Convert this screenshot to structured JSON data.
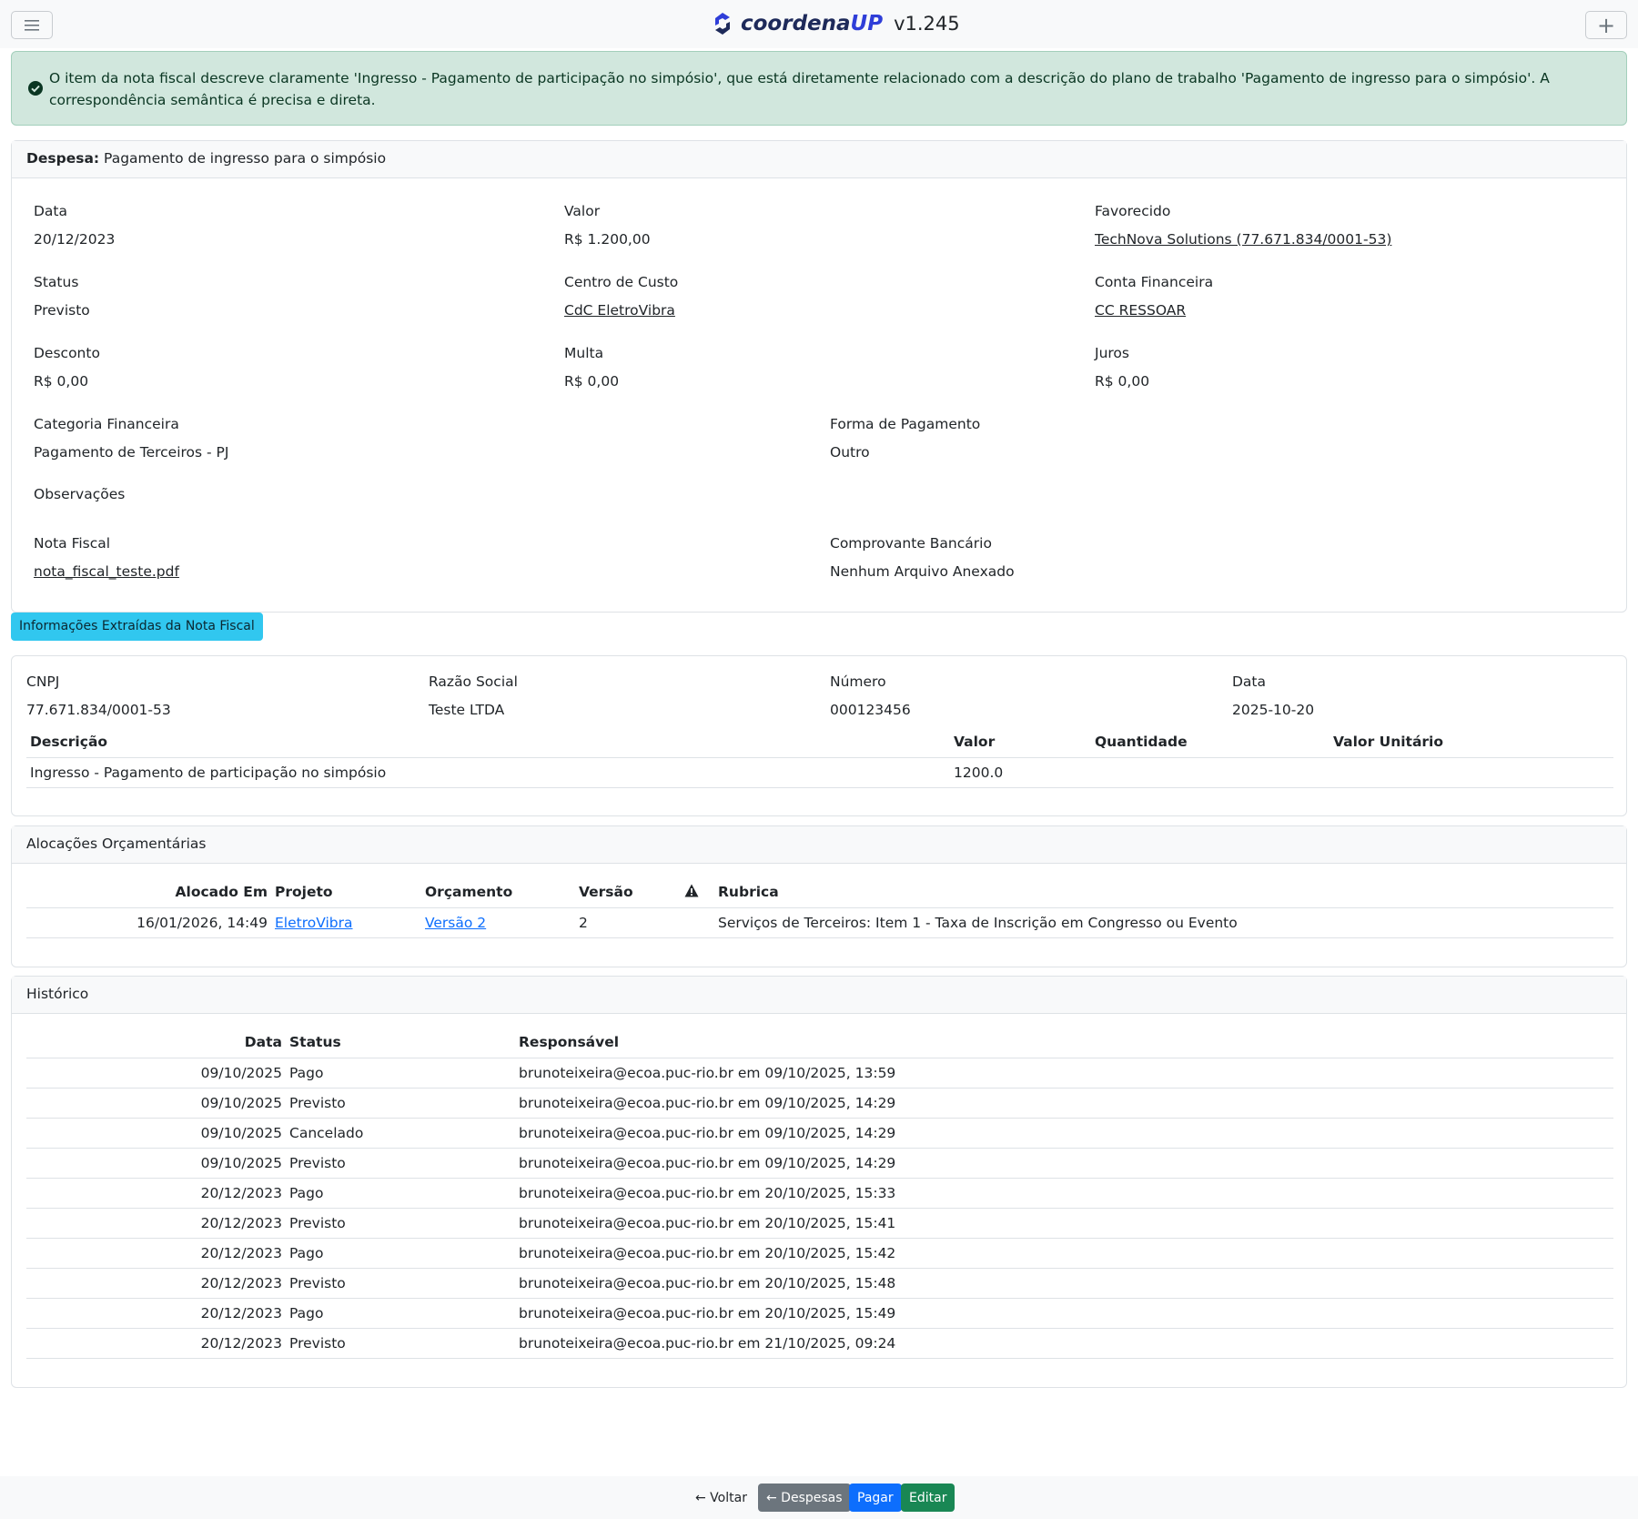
{
  "header": {
    "brand_name": "coordena",
    "brand_up": "UP",
    "version": "v1.245"
  },
  "alert": {
    "text": "O item da nota fiscal descreve claramente 'Ingresso - Pagamento de participação no simpósio', que está diretamente relacionado com a descrição do plano de trabalho 'Pagamento de ingresso para o simpósio'. A correspondência semântica é precisa e direta."
  },
  "expense": {
    "header_label": "Despesa:",
    "header_value": "Pagamento de ingresso para o simpósio",
    "fields": {
      "data_label": "Data",
      "data_value": "20/12/2023",
      "valor_label": "Valor",
      "valor_value": "R$ 1.200,00",
      "favorecido_label": "Favorecido",
      "favorecido_value": "TechNova Solutions (77.671.834/0001-53)",
      "status_label": "Status",
      "status_value": "Previsto",
      "centro_label": "Centro de Custo",
      "centro_value": "CdC EletroVibra",
      "conta_label": "Conta Financeira",
      "conta_value": "CC RESSOAR",
      "desconto_label": "Desconto",
      "desconto_value": "R$ 0,00",
      "multa_label": "Multa",
      "multa_value": "R$ 0,00",
      "juros_label": "Juros",
      "juros_value": "R$ 0,00",
      "categoria_label": "Categoria Financeira",
      "categoria_value": "Pagamento de Terceiros - PJ",
      "forma_label": "Forma de Pagamento",
      "forma_value": "Outro",
      "obs_label": "Observações",
      "nota_label": "Nota Fiscal",
      "nota_value": "nota_fiscal_teste.pdf",
      "comprovante_label": "Comprovante Bancário",
      "comprovante_value": "Nenhum Arquivo Anexado"
    }
  },
  "extracted": {
    "badge": "Informações Extraídas da Nota Fiscal",
    "cnpj_label": "CNPJ",
    "cnpj_value": "77.671.834/0001-53",
    "razao_label": "Razão Social",
    "razao_value": "Teste LTDA",
    "numero_label": "Número",
    "numero_value": "000123456",
    "data_label": "Data",
    "data_value": "2025-10-20",
    "columns": [
      "Descrição",
      "Valor",
      "Quantidade",
      "Valor Unitário"
    ],
    "rows": [
      {
        "descricao": "Ingresso - Pagamento de participação no simpósio",
        "valor": "1200.0",
        "quantidade": "",
        "valor_unitario": ""
      }
    ]
  },
  "allocations": {
    "title": "Alocações Orçamentárias",
    "columns": [
      "Alocado Em",
      "Projeto",
      "Orçamento",
      "Versão",
      "",
      "Rubrica"
    ],
    "rows": [
      {
        "alocado_em": "16/01/2026, 14:49",
        "projeto": "EletroVibra",
        "orcamento": "Versão 2",
        "versao": "2",
        "rubrica": "Serviços de Terceiros: Item 1 - Taxa de Inscrição em Congresso ou Evento"
      }
    ]
  },
  "history": {
    "title": "Histórico",
    "columns": [
      "Data",
      "Status",
      "Responsável"
    ],
    "rows": [
      {
        "data": "09/10/2025",
        "status": "Pago",
        "responsavel": "brunoteixeira@ecoa.puc-rio.br em 09/10/2025, 13:59"
      },
      {
        "data": "09/10/2025",
        "status": "Previsto",
        "responsavel": "brunoteixeira@ecoa.puc-rio.br em 09/10/2025, 14:29"
      },
      {
        "data": "09/10/2025",
        "status": "Cancelado",
        "responsavel": "brunoteixeira@ecoa.puc-rio.br em 09/10/2025, 14:29"
      },
      {
        "data": "09/10/2025",
        "status": "Previsto",
        "responsavel": "brunoteixeira@ecoa.puc-rio.br em 09/10/2025, 14:29"
      },
      {
        "data": "20/12/2023",
        "status": "Pago",
        "responsavel": "brunoteixeira@ecoa.puc-rio.br em 20/10/2025, 15:33"
      },
      {
        "data": "20/12/2023",
        "status": "Previsto",
        "responsavel": "brunoteixeira@ecoa.puc-rio.br em 20/10/2025, 15:41"
      },
      {
        "data": "20/12/2023",
        "status": "Pago",
        "responsavel": "brunoteixeira@ecoa.puc-rio.br em 20/10/2025, 15:42"
      },
      {
        "data": "20/12/2023",
        "status": "Previsto",
        "responsavel": "brunoteixeira@ecoa.puc-rio.br em 20/10/2025, 15:48"
      },
      {
        "data": "20/12/2023",
        "status": "Pago",
        "responsavel": "brunoteixeira@ecoa.puc-rio.br em 20/10/2025, 15:49"
      },
      {
        "data": "20/12/2023",
        "status": "Previsto",
        "responsavel": "brunoteixeira@ecoa.puc-rio.br em 21/10/2025, 09:24"
      }
    ]
  },
  "footer": {
    "voltar": "← Voltar",
    "despesas": "← Despesas",
    "pagar": "Pagar",
    "editar": "Editar"
  }
}
